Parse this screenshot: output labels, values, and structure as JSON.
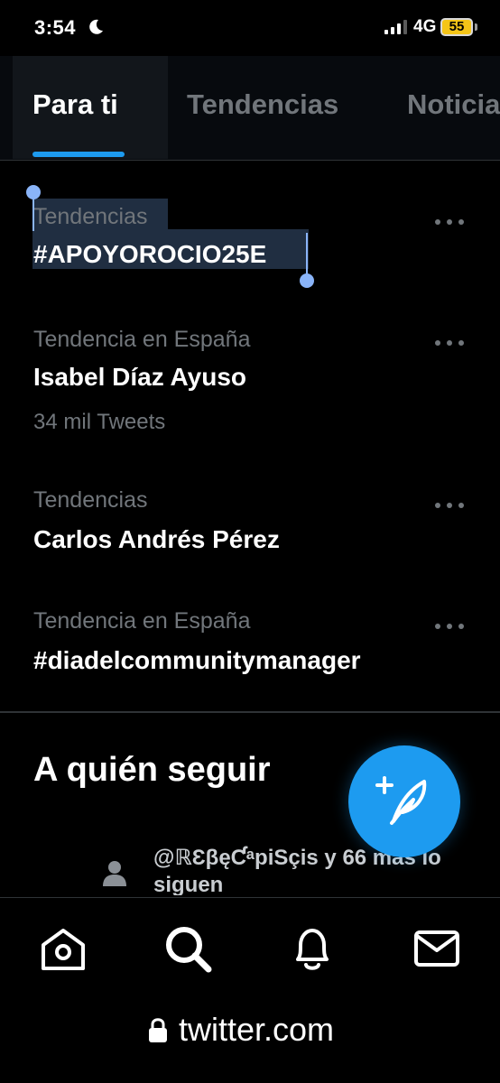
{
  "status_bar": {
    "time": "3:54",
    "network": "4G",
    "battery": "55",
    "icons": [
      "moon-icon",
      "signal-icon",
      "battery-icon"
    ]
  },
  "tabs": [
    {
      "label": "Para ti",
      "active": true
    },
    {
      "label": "Tendencias",
      "active": false
    },
    {
      "label": "Noticia",
      "active": false
    }
  ],
  "trends": [
    {
      "context": "Tendencias",
      "name": "#APOYOROCIO25E",
      "count": ""
    },
    {
      "context": "Tendencia en España",
      "name": "Isabel Díaz Ayuso",
      "count": "34 mil Tweets"
    },
    {
      "context": "Tendencias",
      "name": "Carlos Andrés Pérez",
      "count": ""
    },
    {
      "context": "Tendencia en España",
      "name": "#diadelcommunitymanager",
      "count": ""
    }
  ],
  "who_to_follow": {
    "title": "A quién seguir",
    "followed_by": "@ℝƐβęƇᵃpiSçis y 66 más lo siguen"
  },
  "compose_button": {
    "icon": "compose-tweet-icon"
  },
  "bottom_nav": {
    "items": [
      {
        "icon": "home-icon"
      },
      {
        "icon": "search-icon"
      },
      {
        "icon": "notifications-bell-icon"
      },
      {
        "icon": "messages-envelope-icon"
      }
    ]
  },
  "browser": {
    "url": "twitter.com"
  },
  "colors": {
    "accent": "#1d9bf0",
    "background": "#000000",
    "secondary_text": "#71767b",
    "battery": "#f5c518",
    "selection": "#3a5476"
  }
}
